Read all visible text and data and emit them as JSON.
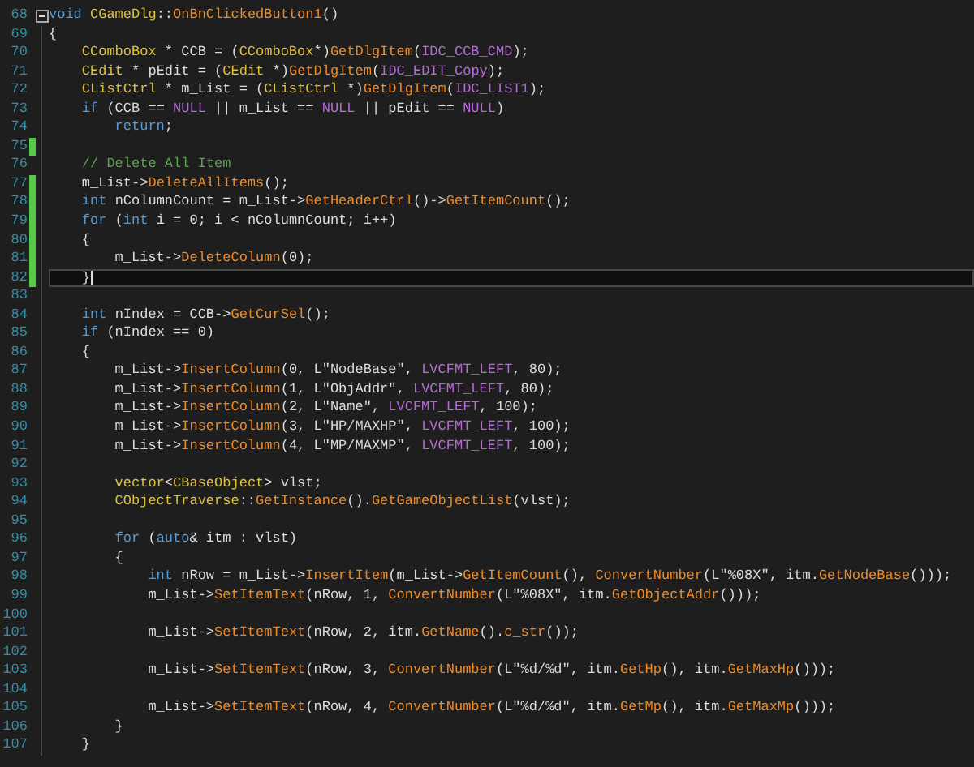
{
  "editor": {
    "lines": [
      {
        "number": "68",
        "foldable": true,
        "changed": false,
        "current": false,
        "tokens": [
          {
            "text": "void",
            "kind": "keyword"
          },
          {
            "text": " CGameDlg",
            "kind": "type"
          },
          {
            "text": "::",
            "kind": "plain"
          },
          {
            "text": "OnBnClickedButton1",
            "kind": "function"
          },
          {
            "text": "()",
            "kind": "plain"
          }
        ]
      },
      {
        "number": "69",
        "foldable": false,
        "changed": false,
        "current": false,
        "tokens": [
          {
            "text": "{",
            "kind": "plain"
          }
        ]
      },
      {
        "number": "70",
        "foldable": false,
        "changed": false,
        "current": false,
        "tokens": [
          {
            "text": "    CComboBox",
            "kind": "type"
          },
          {
            "text": " * CCB = (",
            "kind": "plain"
          },
          {
            "text": "CComboBox",
            "kind": "type"
          },
          {
            "text": "*)",
            "kind": "plain"
          },
          {
            "text": "GetDlgItem",
            "kind": "function"
          },
          {
            "text": "(",
            "kind": "plain"
          },
          {
            "text": "IDC_CCB_CMD",
            "kind": "macro"
          },
          {
            "text": ");",
            "kind": "plain"
          }
        ]
      },
      {
        "number": "71",
        "foldable": false,
        "changed": false,
        "current": false,
        "tokens": [
          {
            "text": "    CEdit",
            "kind": "type"
          },
          {
            "text": " * pEdit = (",
            "kind": "plain"
          },
          {
            "text": "CEdit",
            "kind": "type"
          },
          {
            "text": " *)",
            "kind": "plain"
          },
          {
            "text": "GetDlgItem",
            "kind": "function"
          },
          {
            "text": "(",
            "kind": "plain"
          },
          {
            "text": "IDC_EDIT_Copy",
            "kind": "macro"
          },
          {
            "text": ");",
            "kind": "plain"
          }
        ]
      },
      {
        "number": "72",
        "foldable": false,
        "changed": false,
        "current": false,
        "tokens": [
          {
            "text": "    CListCtrl",
            "kind": "type"
          },
          {
            "text": " * m_List = (",
            "kind": "plain"
          },
          {
            "text": "CListCtrl",
            "kind": "type"
          },
          {
            "text": " *)",
            "kind": "plain"
          },
          {
            "text": "GetDlgItem",
            "kind": "function"
          },
          {
            "text": "(",
            "kind": "plain"
          },
          {
            "text": "IDC_LIST1",
            "kind": "macro"
          },
          {
            "text": ");",
            "kind": "plain"
          }
        ]
      },
      {
        "number": "73",
        "foldable": false,
        "changed": false,
        "current": false,
        "tokens": [
          {
            "text": "    if",
            "kind": "keyword"
          },
          {
            "text": " (CCB == ",
            "kind": "plain"
          },
          {
            "text": "NULL",
            "kind": "macro"
          },
          {
            "text": " || m_List == ",
            "kind": "plain"
          },
          {
            "text": "NULL",
            "kind": "macro"
          },
          {
            "text": " || pEdit == ",
            "kind": "plain"
          },
          {
            "text": "NULL",
            "kind": "macro"
          },
          {
            "text": ")",
            "kind": "plain"
          }
        ]
      },
      {
        "number": "74",
        "foldable": false,
        "changed": false,
        "current": false,
        "tokens": [
          {
            "text": "        return",
            "kind": "keyword"
          },
          {
            "text": ";",
            "kind": "plain"
          }
        ]
      },
      {
        "number": "75",
        "foldable": false,
        "changed": true,
        "current": false
      },
      {
        "number": "76",
        "foldable": false,
        "changed": false,
        "current": false,
        "tokens": [
          {
            "text": "    // Delete All Item",
            "kind": "comment"
          }
        ]
      },
      {
        "number": "77",
        "foldable": false,
        "changed": true,
        "current": false,
        "tokens": [
          {
            "text": "    m_List->",
            "kind": "plain"
          },
          {
            "text": "DeleteAllItems",
            "kind": "function"
          },
          {
            "text": "();",
            "kind": "plain"
          }
        ]
      },
      {
        "number": "78",
        "foldable": false,
        "changed": true,
        "current": false,
        "tokens": [
          {
            "text": "    int",
            "kind": "keyword"
          },
          {
            "text": " nColumnCount = m_List->",
            "kind": "plain"
          },
          {
            "text": "GetHeaderCtrl",
            "kind": "function"
          },
          {
            "text": "()->",
            "kind": "plain"
          },
          {
            "text": "GetItemCount",
            "kind": "function"
          },
          {
            "text": "();",
            "kind": "plain"
          }
        ]
      },
      {
        "number": "79",
        "foldable": false,
        "changed": true,
        "current": false,
        "tokens": [
          {
            "text": "    for",
            "kind": "keyword"
          },
          {
            "text": " (",
            "kind": "plain"
          },
          {
            "text": "int",
            "kind": "keyword"
          },
          {
            "text": " i = 0; i < nColumnCount; i++)",
            "kind": "plain"
          }
        ]
      },
      {
        "number": "80",
        "foldable": false,
        "changed": true,
        "current": false,
        "tokens": [
          {
            "text": "    {",
            "kind": "plain"
          }
        ]
      },
      {
        "number": "81",
        "foldable": false,
        "changed": true,
        "current": false,
        "tokens": [
          {
            "text": "        m_List->",
            "kind": "plain"
          },
          {
            "text": "DeleteColumn",
            "kind": "function"
          },
          {
            "text": "(0);",
            "kind": "plain"
          }
        ]
      },
      {
        "number": "82",
        "foldable": false,
        "changed": true,
        "current": true,
        "tokens": [
          {
            "text": "    }",
            "kind": "plain"
          }
        ]
      },
      {
        "number": "83",
        "foldable": false,
        "changed": false,
        "current": false
      },
      {
        "number": "84",
        "foldable": false,
        "changed": false,
        "current": false,
        "tokens": [
          {
            "text": "    int",
            "kind": "keyword"
          },
          {
            "text": " nIndex = CCB->",
            "kind": "plain"
          },
          {
            "text": "GetCurSel",
            "kind": "function"
          },
          {
            "text": "();",
            "kind": "plain"
          }
        ]
      },
      {
        "number": "85",
        "foldable": false,
        "changed": false,
        "current": false,
        "tokens": [
          {
            "text": "    if",
            "kind": "keyword"
          },
          {
            "text": " (nIndex == 0)",
            "kind": "plain"
          }
        ]
      },
      {
        "number": "86",
        "foldable": false,
        "changed": false,
        "current": false,
        "tokens": [
          {
            "text": "    {",
            "kind": "plain"
          }
        ]
      },
      {
        "number": "87",
        "foldable": false,
        "changed": false,
        "current": false,
        "tokens": [
          {
            "text": "        m_List->",
            "kind": "plain"
          },
          {
            "text": "InsertColumn",
            "kind": "function"
          },
          {
            "text": "(0, L\"NodeBase\", ",
            "kind": "plain"
          },
          {
            "text": "LVCFMT_LEFT",
            "kind": "macro"
          },
          {
            "text": ", 80);",
            "kind": "plain"
          }
        ]
      },
      {
        "number": "88",
        "foldable": false,
        "changed": false,
        "current": false,
        "tokens": [
          {
            "text": "        m_List->",
            "kind": "plain"
          },
          {
            "text": "InsertColumn",
            "kind": "function"
          },
          {
            "text": "(1, L\"ObjAddr\", ",
            "kind": "plain"
          },
          {
            "text": "LVCFMT_LEFT",
            "kind": "macro"
          },
          {
            "text": ", 80);",
            "kind": "plain"
          }
        ]
      },
      {
        "number": "89",
        "foldable": false,
        "changed": false,
        "current": false,
        "tokens": [
          {
            "text": "        m_List->",
            "kind": "plain"
          },
          {
            "text": "InsertColumn",
            "kind": "function"
          },
          {
            "text": "(2, L\"Name\", ",
            "kind": "plain"
          },
          {
            "text": "LVCFMT_LEFT",
            "kind": "macro"
          },
          {
            "text": ", 100);",
            "kind": "plain"
          }
        ]
      },
      {
        "number": "90",
        "foldable": false,
        "changed": false,
        "current": false,
        "tokens": [
          {
            "text": "        m_List->",
            "kind": "plain"
          },
          {
            "text": "InsertColumn",
            "kind": "function"
          },
          {
            "text": "(3, L\"HP/MAXHP\", ",
            "kind": "plain"
          },
          {
            "text": "LVCFMT_LEFT",
            "kind": "macro"
          },
          {
            "text": ", 100);",
            "kind": "plain"
          }
        ]
      },
      {
        "number": "91",
        "foldable": false,
        "changed": false,
        "current": false,
        "tokens": [
          {
            "text": "        m_List->",
            "kind": "plain"
          },
          {
            "text": "InsertColumn",
            "kind": "function"
          },
          {
            "text": "(4, L\"MP/MAXMP\", ",
            "kind": "plain"
          },
          {
            "text": "LVCFMT_LEFT",
            "kind": "macro"
          },
          {
            "text": ", 100);",
            "kind": "plain"
          }
        ]
      },
      {
        "number": "92",
        "foldable": false,
        "changed": false,
        "current": false
      },
      {
        "number": "93",
        "foldable": false,
        "changed": false,
        "current": false,
        "tokens": [
          {
            "text": "        vector",
            "kind": "type"
          },
          {
            "text": "<",
            "kind": "plain"
          },
          {
            "text": "CBaseObject",
            "kind": "type"
          },
          {
            "text": "> vlst;",
            "kind": "plain"
          }
        ]
      },
      {
        "number": "94",
        "foldable": false,
        "changed": false,
        "current": false,
        "tokens": [
          {
            "text": "        CObjectTraverse",
            "kind": "type"
          },
          {
            "text": "::",
            "kind": "plain"
          },
          {
            "text": "GetInstance",
            "kind": "function"
          },
          {
            "text": "().",
            "kind": "plain"
          },
          {
            "text": "GetGameObjectList",
            "kind": "function"
          },
          {
            "text": "(vlst);",
            "kind": "plain"
          }
        ]
      },
      {
        "number": "95",
        "foldable": false,
        "changed": false,
        "current": false
      },
      {
        "number": "96",
        "foldable": false,
        "changed": false,
        "current": false,
        "tokens": [
          {
            "text": "        for",
            "kind": "keyword"
          },
          {
            "text": " (",
            "kind": "plain"
          },
          {
            "text": "auto",
            "kind": "keyword"
          },
          {
            "text": "& itm : vlst)",
            "kind": "plain"
          }
        ]
      },
      {
        "number": "97",
        "foldable": false,
        "changed": false,
        "current": false,
        "tokens": [
          {
            "text": "        {",
            "kind": "plain"
          }
        ]
      },
      {
        "number": "98",
        "foldable": false,
        "changed": false,
        "current": false,
        "tokens": [
          {
            "text": "            int",
            "kind": "keyword"
          },
          {
            "text": " nRow = m_List->",
            "kind": "plain"
          },
          {
            "text": "InsertItem",
            "kind": "function"
          },
          {
            "text": "(m_List->",
            "kind": "plain"
          },
          {
            "text": "GetItemCount",
            "kind": "function"
          },
          {
            "text": "(), ",
            "kind": "plain"
          },
          {
            "text": "ConvertNumber",
            "kind": "function"
          },
          {
            "text": "(L\"%08X\", itm.",
            "kind": "plain"
          },
          {
            "text": "GetNodeBase",
            "kind": "function"
          },
          {
            "text": "()));",
            "kind": "plain"
          }
        ]
      },
      {
        "number": "99",
        "foldable": false,
        "changed": false,
        "current": false,
        "tokens": [
          {
            "text": "            m_List->",
            "kind": "plain"
          },
          {
            "text": "SetItemText",
            "kind": "function"
          },
          {
            "text": "(nRow, 1, ",
            "kind": "plain"
          },
          {
            "text": "ConvertNumber",
            "kind": "function"
          },
          {
            "text": "(L\"%08X\", itm.",
            "kind": "plain"
          },
          {
            "text": "GetObjectAddr",
            "kind": "function"
          },
          {
            "text": "()));",
            "kind": "plain"
          }
        ]
      },
      {
        "number": "100",
        "foldable": false,
        "changed": false,
        "current": false
      },
      {
        "number": "101",
        "foldable": false,
        "changed": false,
        "current": false,
        "tokens": [
          {
            "text": "            m_List->",
            "kind": "plain"
          },
          {
            "text": "SetItemText",
            "kind": "function"
          },
          {
            "text": "(nRow, 2, itm.",
            "kind": "plain"
          },
          {
            "text": "GetName",
            "kind": "function"
          },
          {
            "text": "().",
            "kind": "plain"
          },
          {
            "text": "c_str",
            "kind": "function"
          },
          {
            "text": "());",
            "kind": "plain"
          }
        ]
      },
      {
        "number": "102",
        "foldable": false,
        "changed": false,
        "current": false
      },
      {
        "number": "103",
        "foldable": false,
        "changed": false,
        "current": false,
        "tokens": [
          {
            "text": "            m_List->",
            "kind": "plain"
          },
          {
            "text": "SetItemText",
            "kind": "function"
          },
          {
            "text": "(nRow, 3, ",
            "kind": "plain"
          },
          {
            "text": "ConvertNumber",
            "kind": "function"
          },
          {
            "text": "(L\"%d/%d\", itm.",
            "kind": "plain"
          },
          {
            "text": "GetHp",
            "kind": "function"
          },
          {
            "text": "(), itm.",
            "kind": "plain"
          },
          {
            "text": "GetMaxHp",
            "kind": "function"
          },
          {
            "text": "()));",
            "kind": "plain"
          }
        ]
      },
      {
        "number": "104",
        "foldable": false,
        "changed": false,
        "current": false
      },
      {
        "number": "105",
        "foldable": false,
        "changed": false,
        "current": false,
        "tokens": [
          {
            "text": "            m_List->",
            "kind": "plain"
          },
          {
            "text": "SetItemText",
            "kind": "function"
          },
          {
            "text": "(nRow, 4, ",
            "kind": "plain"
          },
          {
            "text": "ConvertNumber",
            "kind": "function"
          },
          {
            "text": "(L\"%d/%d\", itm.",
            "kind": "plain"
          },
          {
            "text": "GetMp",
            "kind": "function"
          },
          {
            "text": "(), itm.",
            "kind": "plain"
          },
          {
            "text": "GetMaxMp",
            "kind": "function"
          },
          {
            "text": "()));",
            "kind": "plain"
          }
        ]
      },
      {
        "number": "106",
        "foldable": false,
        "changed": false,
        "current": false,
        "tokens": [
          {
            "text": "        }",
            "kind": "plain"
          }
        ]
      },
      {
        "number": "107",
        "foldable": false,
        "changed": false,
        "current": false,
        "tokens": [
          {
            "text": "    }",
            "kind": "plain"
          }
        ]
      }
    ]
  }
}
